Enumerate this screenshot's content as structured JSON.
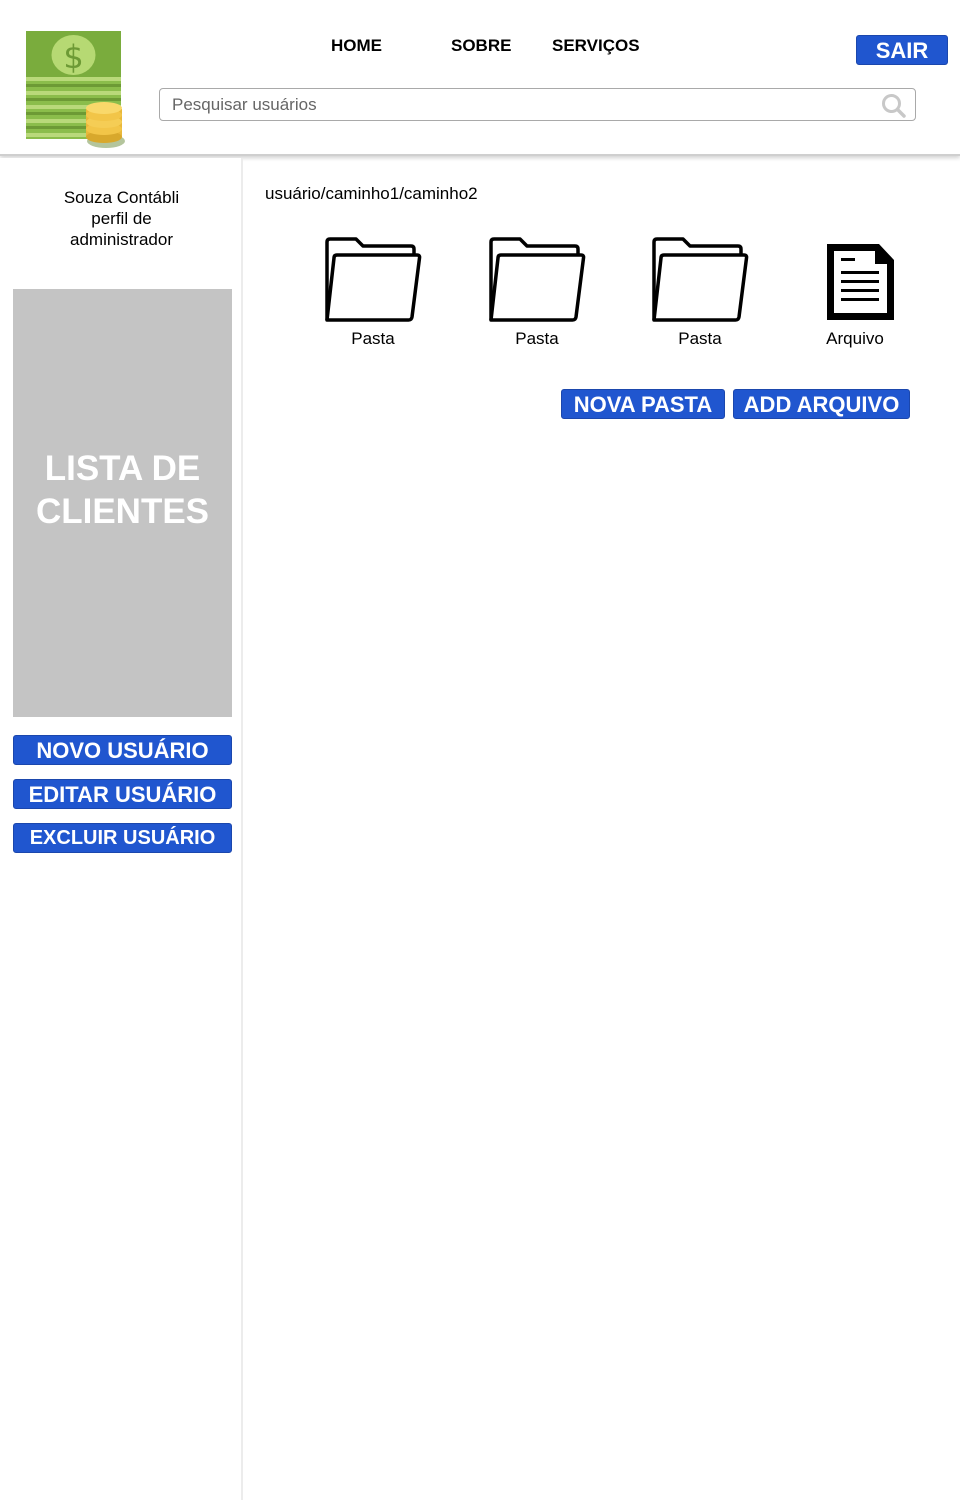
{
  "header": {
    "nav": {
      "home": "HOME",
      "sobre": "SOBRE",
      "servicos": "SERVIÇOS"
    },
    "logout_label": "SAIR",
    "search": {
      "placeholder": "Pesquisar usuários",
      "value": ""
    },
    "logo_icon": "money-stack-coins-icon"
  },
  "sidebar": {
    "company_name": "Souza Contábli",
    "profile_line1": "perfil de",
    "profile_line2": "administrador",
    "client_list_title": "LISTA DE\nCLIENTES",
    "buttons": {
      "new_user": "NOVO USUÁRIO",
      "edit_user": "EDITAR USUÁRIO",
      "delete_user": "EXCLUIR USUÁRIO"
    }
  },
  "main": {
    "breadcrumb": "usuário/caminho1/caminho2",
    "items": [
      {
        "label": "Pasta",
        "icon": "folder-icon"
      },
      {
        "label": "Pasta",
        "icon": "folder-icon"
      },
      {
        "label": "Pasta",
        "icon": "folder-icon"
      },
      {
        "label": "Arquivo",
        "icon": "document-icon"
      }
    ],
    "buttons": {
      "new_folder": "NOVA PASTA",
      "add_file": "ADD ARQUIVO"
    }
  },
  "colors": {
    "primary_button": "#2056cf",
    "client_list_bg": "#c4c4c4",
    "logo_green": "#7cad44",
    "logo_coin": "#f0c040"
  }
}
